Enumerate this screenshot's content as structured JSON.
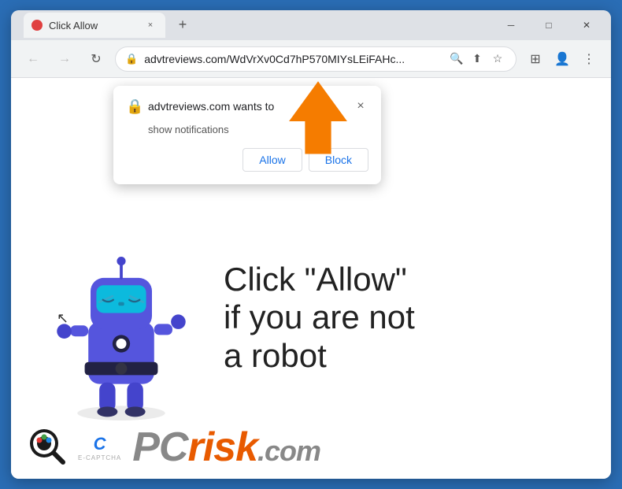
{
  "browser": {
    "tab": {
      "favicon_color": "#e04040",
      "title": "Click Allow",
      "close_label": "×"
    },
    "new_tab_label": "+",
    "nav": {
      "back_label": "←",
      "forward_label": "→",
      "reload_label": "↻"
    },
    "url": "advtreviews.com/WdVrXv0Cd7hP570MIYsLEiFAHc...",
    "url_icons": {
      "search": "🔍",
      "share": "⬆",
      "bookmark": "☆",
      "extension": "⊞",
      "profile": "👤",
      "menu": "⋮"
    },
    "window_controls": {
      "minimize": "─",
      "maximize": "□",
      "close": "✕"
    }
  },
  "notification_popup": {
    "site": "advtreviews.com wants to",
    "subtitle": "show notifications",
    "close_label": "×",
    "allow_label": "Allow",
    "block_label": "Block"
  },
  "page": {
    "message_line1": "Click \"Allow\"",
    "message_line2": "if you are not",
    "message_line3": "a robot",
    "question_marks": "??",
    "cursor": "↖"
  },
  "branding": {
    "ecaptcha_letter": "C",
    "ecaptcha_label": "E-CAPTCHA",
    "pc_text": "PC",
    "risk_text": "risk",
    "dotcom": ".com"
  }
}
